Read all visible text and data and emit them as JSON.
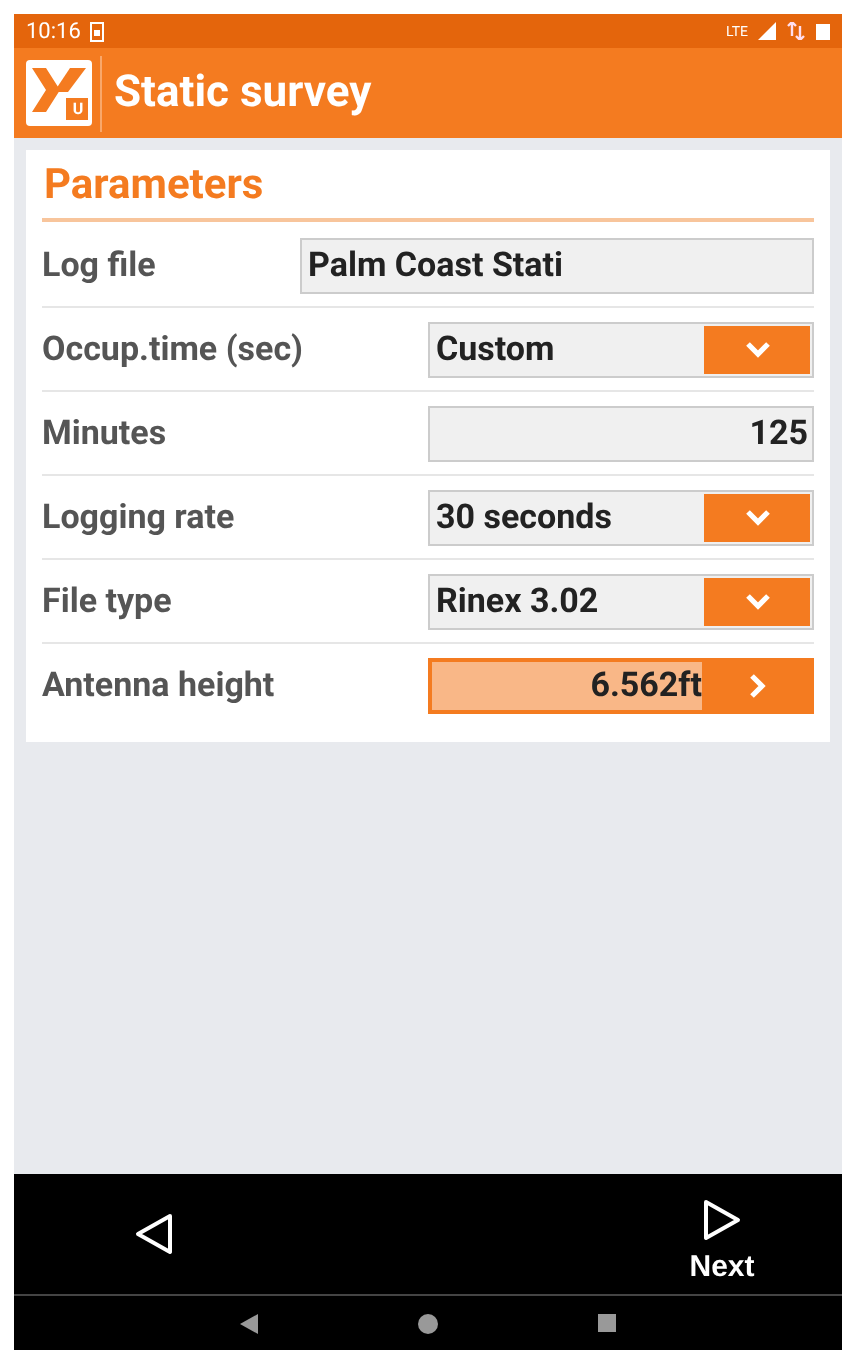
{
  "status_bar": {
    "time": "10:16",
    "network": "LTE"
  },
  "app_bar": {
    "title": "Static survey",
    "logo_badge": "U"
  },
  "section": {
    "title": "Parameters"
  },
  "rows": [
    {
      "label": "Log file",
      "kind": "text",
      "value": "Palm Coast Stati"
    },
    {
      "label": "Occup.time (sec)",
      "kind": "dropdown",
      "value": "Custom"
    },
    {
      "label": "Minutes",
      "kind": "number",
      "value": "125"
    },
    {
      "label": "Logging rate",
      "kind": "dropdown",
      "value": "30 seconds"
    },
    {
      "label": "File type",
      "kind": "dropdown",
      "value": "Rinex 3.02"
    },
    {
      "label": "Antenna height",
      "kind": "action",
      "value": "6.562ft"
    }
  ],
  "bottom_bar": {
    "next_label": "Next"
  }
}
